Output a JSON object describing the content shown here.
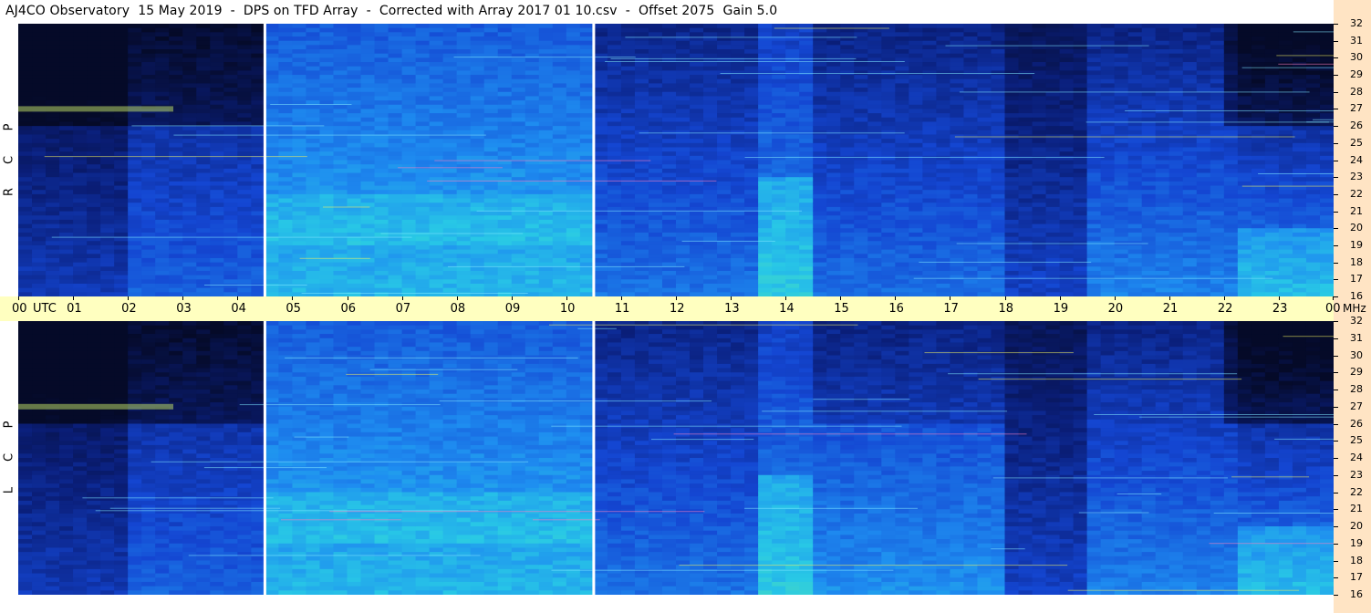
{
  "title": "AJ4CO Observatory  15 May 2019  -  DPS on TFD Array  -  Corrected with Array 2017 01 10.csv  -  Offset 2075  Gain 5.0",
  "panels": [
    {
      "name": "rcp",
      "letters": [
        "R",
        "C",
        "P"
      ]
    },
    {
      "name": "lcp",
      "letters": [
        "L",
        "C",
        "P"
      ]
    }
  ],
  "colors": {
    "background": "#ffffff",
    "time_axis_bg": "#ffffc0",
    "freq_axis_bg": "#ffe4c4",
    "gap_line": "#ffffff"
  },
  "chart_data": {
    "type": "heatmap",
    "title": "AJ4CO Observatory  15 May 2019  -  DPS on TFD Array  -  Corrected with Array 2017 01 10.csv  -  Offset 2075  Gain 5.0",
    "xlabel": "UTC",
    "ylabel": "MHz",
    "x_ticks": [
      "00",
      "01",
      "02",
      "03",
      "04",
      "05",
      "06",
      "07",
      "08",
      "09",
      "10",
      "11",
      "12",
      "13",
      "14",
      "15",
      "16",
      "17",
      "18",
      "19",
      "20",
      "21",
      "22",
      "23",
      "00"
    ],
    "x_range_hours": [
      0,
      24
    ],
    "y_ticks": [
      16,
      17,
      18,
      19,
      20,
      21,
      22,
      23,
      24,
      25,
      26,
      27,
      28,
      29,
      30,
      31,
      32
    ],
    "y_range_mhz": [
      16,
      32
    ],
    "data_gaps_utc": [
      4.5,
      10.5
    ],
    "series": [
      {
        "name": "RCP",
        "panel": "top"
      },
      {
        "name": "LCP",
        "panel": "bottom"
      }
    ]
  }
}
